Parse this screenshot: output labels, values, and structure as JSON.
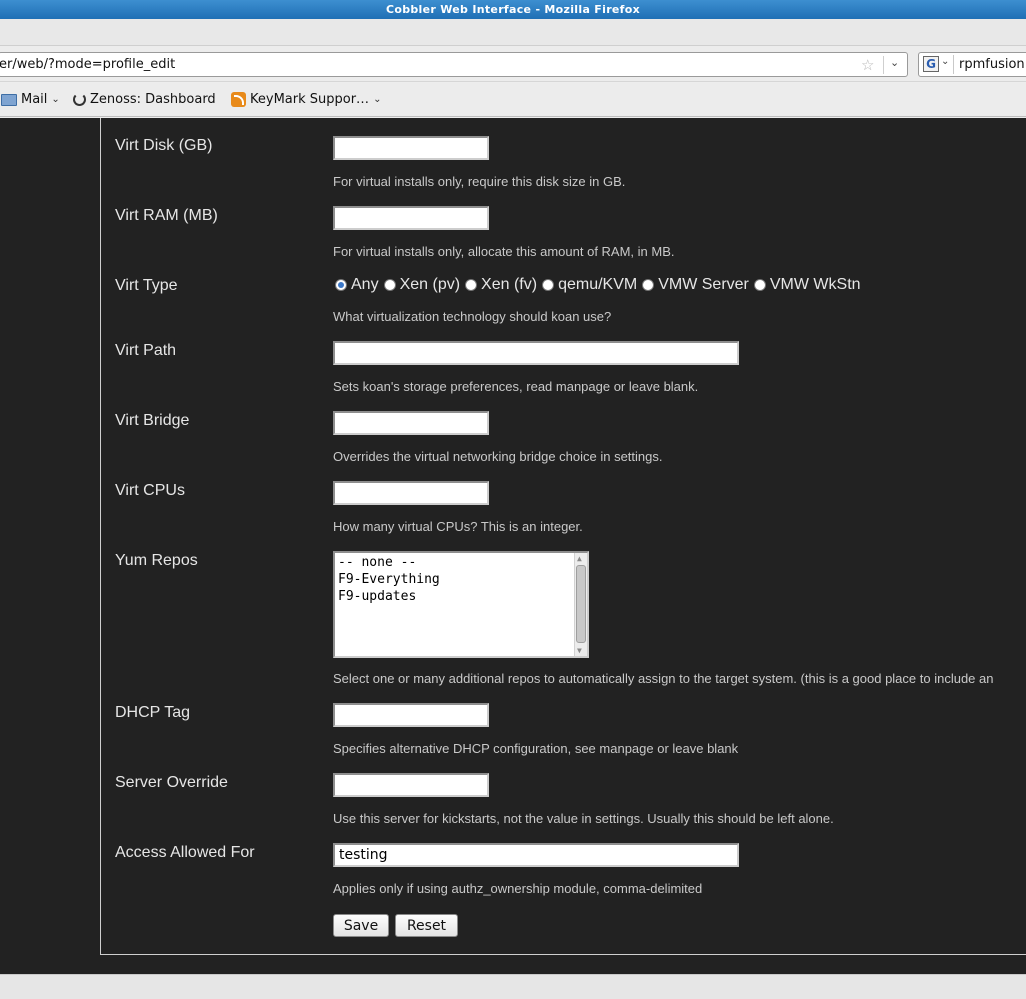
{
  "window": {
    "title": "Cobbler Web Interface - Mozilla Firefox"
  },
  "toolbar": {
    "url": "er/web/?mode=profile_edit",
    "search_value": "rpmfusion"
  },
  "bookmarks": [
    {
      "label": "Mail"
    },
    {
      "label": "Zenoss: Dashboard"
    },
    {
      "label": "KeyMark Suppor…"
    }
  ],
  "form": {
    "virt_disk": {
      "label": "Virt Disk (GB)",
      "value": "",
      "help": "For virtual installs only, require this disk size in GB."
    },
    "virt_ram": {
      "label": "Virt RAM (MB)",
      "value": "",
      "help": "For virtual installs only, allocate this amount of RAM, in MB."
    },
    "virt_type": {
      "label": "Virt Type",
      "options": [
        "Any",
        "Xen (pv)",
        "Xen (fv)",
        "qemu/KVM",
        "VMW Server",
        "VMW WkStn"
      ],
      "selected": "Any",
      "help": "What virtualization technology should koan use?"
    },
    "virt_path": {
      "label": "Virt Path",
      "value": "",
      "help": "Sets koan's storage preferences, read manpage or leave blank."
    },
    "virt_bridge": {
      "label": "Virt Bridge",
      "value": "",
      "help": "Overrides the virtual networking bridge choice in settings."
    },
    "virt_cpus": {
      "label": "Virt CPUs",
      "value": "",
      "help": "How many virtual CPUs? This is an integer."
    },
    "yum_repos": {
      "label": "Yum Repos",
      "options": [
        "-- none --",
        "F9-Everything",
        "F9-updates"
      ],
      "help": "Select one or many additional repos to automatically assign to the target system. (this is a good place to include an"
    },
    "dhcp_tag": {
      "label": "DHCP Tag",
      "value": "",
      "help": "Specifies alternative DHCP configuration, see manpage or leave blank"
    },
    "server_override": {
      "label": "Server Override",
      "value": "",
      "help": "Use this server for kickstarts, not the value in settings. Usually this should be left alone."
    },
    "access_allowed": {
      "label": "Access Allowed For",
      "value": "testing",
      "help": "Applies only if using authz_ownership module, comma-delimited"
    },
    "save_label": "Save",
    "reset_label": "Reset"
  }
}
